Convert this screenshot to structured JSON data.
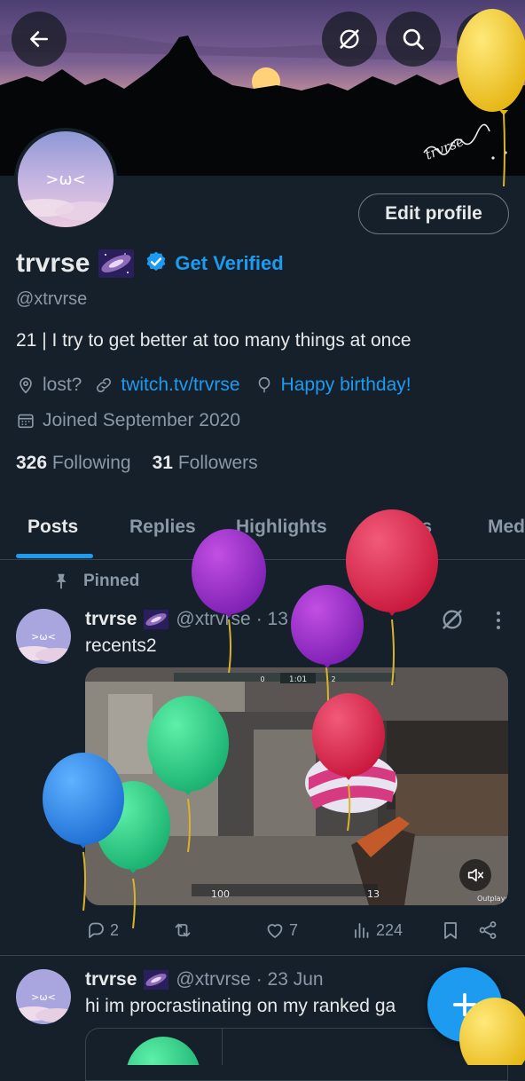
{
  "banner": {
    "signature": "trvrse"
  },
  "header_buttons": [
    "back-icon",
    "grok-off-icon",
    "search-icon",
    "more-icon"
  ],
  "avatar": {
    "text": ">ω<"
  },
  "profile": {
    "edit_label": "Edit profile",
    "name": "trvrse",
    "get_verified": "Get Verified",
    "handle": "@xtrvrse",
    "bio": "21 | I try to get better at too many things at once",
    "location": "lost?",
    "website": "twitch.tv/trvrse",
    "birthday": "Happy birthday!",
    "joined": "Joined September 2020",
    "following_count": "326",
    "following_label": "Following",
    "followers_count": "31",
    "followers_label": "Followers"
  },
  "tabs": [
    {
      "label": "Posts",
      "active": true
    },
    {
      "label": "Replies"
    },
    {
      "label": "Highlights"
    },
    {
      "label": "Articles"
    },
    {
      "label": "Media"
    }
  ],
  "pinned_label": "Pinned",
  "posts": [
    {
      "name": "trvrse",
      "handle": "@xtrvrse",
      "date": "· 13 Dec 24",
      "text": "recents2",
      "media": {
        "hud_health": "100",
        "hud_ammo": "13",
        "round_timer": "1:01",
        "score_left": "0",
        "score_right": "2",
        "watermark": "Outplayed"
      },
      "stats": {
        "replies": "2",
        "reposts": "",
        "likes": "7",
        "views": "224"
      }
    },
    {
      "name": "trvrse",
      "handle": "@xtrvrse",
      "date": "· 23 Jun",
      "text": "hi im procrastinating on my ranked ga"
    }
  ],
  "colors": {
    "accent": "#1d9bf0",
    "background": "#15202b",
    "secondary_text": "#8b98a5"
  }
}
